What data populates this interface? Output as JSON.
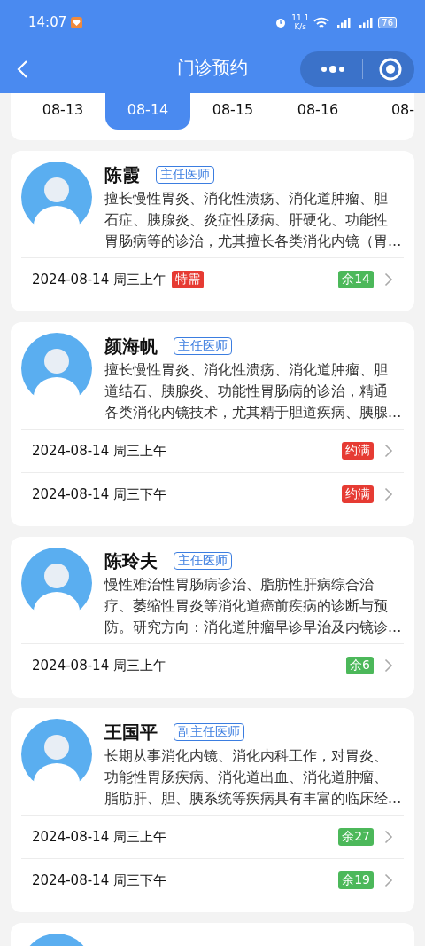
{
  "status_bar": {
    "time": "14:07",
    "speed": "11.1",
    "speed_unit": "K/s",
    "battery": "76"
  },
  "nav": {
    "title": "门诊预约"
  },
  "dates": [
    {
      "label": "08-13",
      "selected": false
    },
    {
      "label": "08-14",
      "selected": true
    },
    {
      "label": "08-15",
      "selected": false
    },
    {
      "label": "08-16",
      "selected": false
    },
    {
      "label": "08-",
      "selected": false
    }
  ],
  "doctors": [
    {
      "name": "陈霞",
      "title": "主任医师",
      "description": "擅长慢性胃炎、消化性溃疡、消化道肿瘤、胆石症、胰腺炎、炎症性肠病、肝硬化、功能性胃肠病等的诊治，尤其擅长各类消化内镜（胃...",
      "slots": [
        {
          "time": "2024-08-14 周三上午",
          "tag": "特需",
          "status": "余14",
          "kind": "remaining"
        }
      ]
    },
    {
      "name": "颜海帆",
      "title": "主任医师",
      "description": "擅长慢性胃炎、消化性溃疡、消化道肿瘤、胆道结石、胰腺炎、功能性胃肠病的诊治，精通各类消化内镜技术，尤其精于胆道疾病、胰腺...",
      "slots": [
        {
          "time": "2024-08-14 周三上午",
          "status": "约满",
          "kind": "full"
        },
        {
          "time": "2024-08-14 周三下午",
          "status": "约满",
          "kind": "full"
        }
      ]
    },
    {
      "name": "陈玲夫",
      "title": "主任医师",
      "description": "慢性难治性胃肠病诊治、脂肪性肝病综合治疗、萎缩性胃炎等消化道癌前疾病的诊断与预防。研究方向：消化道肿瘤早诊早治及内镜诊...",
      "slots": [
        {
          "time": "2024-08-14 周三上午",
          "status": "余6",
          "kind": "remaining"
        }
      ]
    },
    {
      "name": "王国平",
      "title": "副主任医师",
      "description": "长期从事消化内镜、消化内科工作，对胃炎、功能性胃肠疾病、消化道出血、消化道肿瘤、脂肪肝、胆、胰系统等疾病具有丰富的临床经...",
      "slots": [
        {
          "time": "2024-08-14 周三上午",
          "status": "余27",
          "kind": "remaining"
        },
        {
          "time": "2024-08-14 周三下午",
          "status": "余19",
          "kind": "remaining"
        }
      ]
    }
  ]
}
